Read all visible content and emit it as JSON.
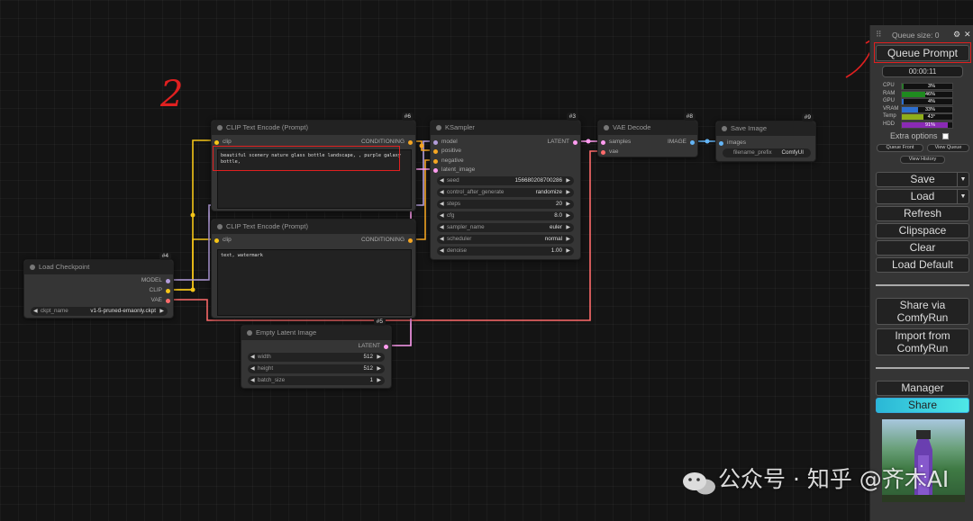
{
  "annotations": {
    "one": "1",
    "two": "2"
  },
  "nodes": {
    "clip_pos": {
      "title": "CLIP Text Encode (Prompt)",
      "id": "#6",
      "input": "clip",
      "output": "CONDITIONING",
      "text": "beautiful scenery nature glass bottle landscape, , purple galaxy bottle,"
    },
    "clip_neg": {
      "title": "CLIP Text Encode (Prompt)",
      "input": "clip",
      "output": "CONDITIONING",
      "text": "text, watermark"
    },
    "ksampler": {
      "title": "KSampler",
      "id": "#3",
      "inputs": [
        "model",
        "positive",
        "negative",
        "latent_image"
      ],
      "output": "LATENT",
      "widgets": [
        {
          "name": "seed",
          "value": "156680208700286"
        },
        {
          "name": "control_after_generate",
          "value": "randomize"
        },
        {
          "name": "steps",
          "value": "20"
        },
        {
          "name": "cfg",
          "value": "8.0"
        },
        {
          "name": "sampler_name",
          "value": "euler"
        },
        {
          "name": "scheduler",
          "value": "normal"
        },
        {
          "name": "denoise",
          "value": "1.00"
        }
      ]
    },
    "vae_decode": {
      "title": "VAE Decode",
      "id": "#8",
      "inputs": [
        "samples",
        "vae"
      ],
      "output": "IMAGE"
    },
    "save_image": {
      "title": "Save Image",
      "id": "#9",
      "input": "images",
      "widget": {
        "name": "filename_prefix",
        "value": "ComfyUI"
      }
    },
    "checkpoint": {
      "title": "Load Checkpoint",
      "id": "#4",
      "outputs": [
        "MODEL",
        "CLIP",
        "VAE"
      ],
      "widget": {
        "name": "ckpt_name",
        "value": "v1-5-pruned-emaonly.ckpt"
      }
    },
    "latent": {
      "title": "Empty Latent Image",
      "id": "#5",
      "output": "LATENT",
      "widgets": [
        {
          "name": "width",
          "value": "512"
        },
        {
          "name": "height",
          "value": "512"
        },
        {
          "name": "batch_size",
          "value": "1"
        }
      ]
    }
  },
  "sidebar": {
    "queue_size": "Queue size: 0",
    "queue_prompt": "Queue Prompt",
    "timer": "00:00:11",
    "stats": [
      {
        "label": "CPU",
        "value": "3%",
        "fraction": 0.03,
        "color": "#2a7a2a"
      },
      {
        "label": "RAM",
        "value": "46%",
        "fraction": 0.46,
        "color": "#1f8a1f"
      },
      {
        "label": "GPU",
        "value": "4%",
        "fraction": 0.04,
        "color": "#2d6fd0"
      },
      {
        "label": "VRAM",
        "value": "33%",
        "fraction": 0.33,
        "color": "#2d6fd0"
      },
      {
        "label": "Temp",
        "value": "43°",
        "fraction": 0.43,
        "color": "#8fae1b"
      },
      {
        "label": "HDD",
        "value": "91%",
        "fraction": 0.91,
        "color": "#8a2ab5"
      }
    ],
    "extra_options": "Extra options",
    "queue_front": "Queue Front",
    "view_queue": "View Queue",
    "view_history": "View History",
    "save": "Save",
    "load": "Load",
    "refresh": "Refresh",
    "clipspace": "Clipspace",
    "clear": "Clear",
    "load_default": "Load Default",
    "share_via_line1": "Share via",
    "share_via_line2": "ComfyRun",
    "import_line1": "Import from",
    "import_line2": "ComfyRun",
    "manager": "Manager",
    "share": "Share"
  },
  "watermark": "公众号 · 知乎 @齐木AI"
}
